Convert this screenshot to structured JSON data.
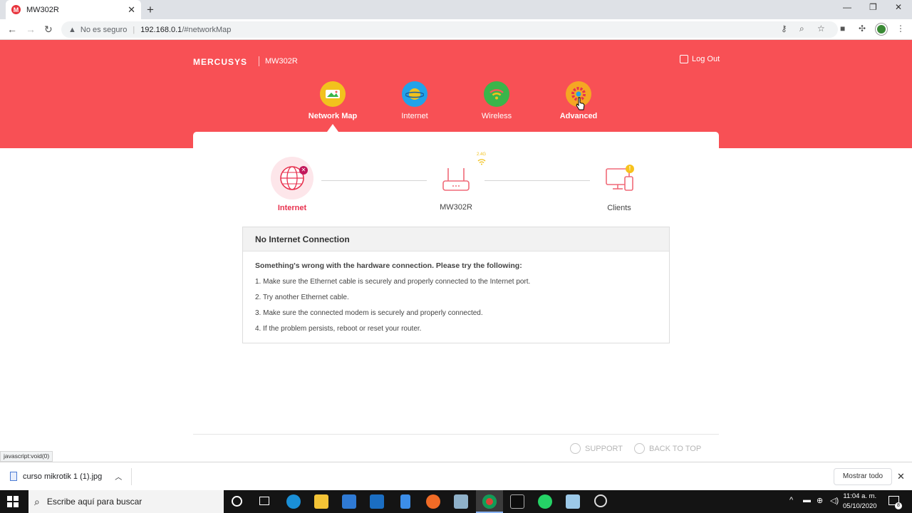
{
  "browser": {
    "tab_title": "MW302R",
    "favicon_letter": "M",
    "new_tab": "+",
    "security_label": "No es seguro",
    "url_host": "192.168.0.1",
    "url_path": "/#networkMap",
    "status_url": "javascript:void(0)"
  },
  "router": {
    "brand": "MERCUSYS",
    "model": "MW302R",
    "logout_label": "Log Out",
    "nav": [
      {
        "label": "Network Map",
        "color": "#f2c21d",
        "icon": "network-map-icon"
      },
      {
        "label": "Internet",
        "color": "#22a2e8",
        "icon": "globe-planet-icon"
      },
      {
        "label": "Wireless",
        "color": "#3ab54a",
        "icon": "wifi-icon"
      },
      {
        "label": "Advanced",
        "color": "#f5a623",
        "icon": "gear-icon"
      }
    ],
    "map": {
      "internet_label": "Internet",
      "router_label": "MW302R",
      "clients_label": "Clients",
      "band_label": "2.4G",
      "clients_badge": "!"
    },
    "status": {
      "title": "No Internet Connection",
      "lead": "Something's wrong with the hardware connection. Please try the following:",
      "steps": [
        "1. Make sure the Ethernet cable is securely and properly connected to the Internet port.",
        "2. Try another Ethernet cable.",
        "3. Make sure the connected modem is securely and properly connected.",
        "4. If the problem persists, reboot or reset your router."
      ]
    },
    "footer": {
      "support_label": "SUPPORT",
      "back_to_top_label": "BACK TO TOP"
    }
  },
  "downloads": {
    "file_name": "curso mikrotik 1 (1).jpg",
    "show_all": "Mostrar todo"
  },
  "taskbar": {
    "search_placeholder": "Escribe aquí para buscar",
    "time": "11:04 a. m.",
    "date": "05/10/2020"
  },
  "colors": {
    "brand_red": "#f85055",
    "error_pink": "#e8324f",
    "warning_yellow": "#f7c21c"
  }
}
